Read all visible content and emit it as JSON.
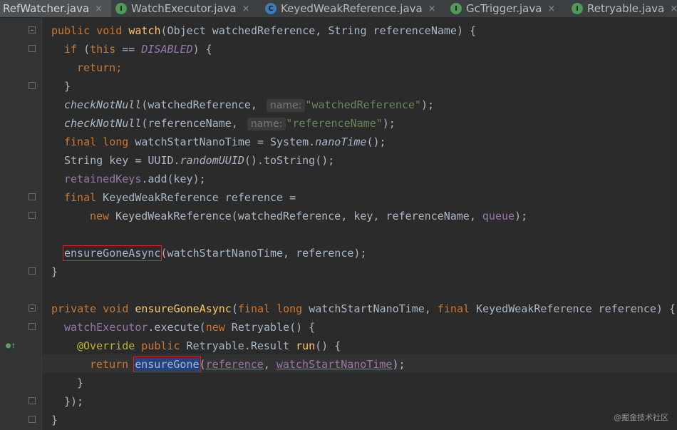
{
  "tabs": [
    {
      "label": "RefWatcher.java",
      "icon": "none",
      "active": true
    },
    {
      "label": "WatchExecutor.java",
      "icon": "interface"
    },
    {
      "label": "KeyedWeakReference.java",
      "icon": "class"
    },
    {
      "label": "GcTrigger.java",
      "icon": "interface"
    },
    {
      "label": "Retryable.java",
      "icon": "interface"
    }
  ],
  "close_glyph": "×",
  "code": {
    "l1": {
      "a": "public void ",
      "b": "watch",
      "c": "(Object watchedReference, String referenceName) {"
    },
    "l2": {
      "a": "if",
      "b": " (",
      "c": "this",
      "d": " == ",
      "e": "DISABLED",
      "f": ") {"
    },
    "l3": {
      "a": "return",
      "b": ";"
    },
    "l4": {
      "a": "}"
    },
    "l5": {
      "a": "checkNotNull",
      "b": "(watchedReference, ",
      "hint": "name:",
      "str": "\"watchedReference\"",
      "c": ");"
    },
    "l6": {
      "a": "checkNotNull",
      "b": "(referenceName, ",
      "hint": "name:",
      "str": "\"referenceName\"",
      "c": ");"
    },
    "l7": {
      "a": "final long",
      "b": " watchStartNanoTime = System.",
      "c": "nanoTime",
      "d": "();"
    },
    "l8": {
      "a": "String key = UUID.",
      "b": "randomUUID",
      "c": "().toString();"
    },
    "l9": {
      "a": "retainedKeys",
      "b": ".add(key);"
    },
    "l10": {
      "a": "final",
      "b": " KeyedWeakReference reference ="
    },
    "l11": {
      "a": "new",
      "b": " KeyedWeakReference(watchedReference, key, referenceName, ",
      "c": "queue",
      "d": ");"
    },
    "l12": {
      "a": "ensureGoneAsync",
      "b": "(watchStartNanoTime, reference);"
    },
    "l13": {
      "a": "}"
    },
    "l14": {
      "a": "private void ",
      "b": "ensureGoneAsync",
      "c": "(",
      "d": "final long",
      "e": " watchStartNanoTime, ",
      "f": "final",
      "g": " KeyedWeakReference reference) {"
    },
    "l15": {
      "a": "watchExecutor",
      "b": ".execute(",
      "c": "new",
      "d": " Retryable() {"
    },
    "l16": {
      "a": "@Override",
      "b": " public",
      "c": " Retryable.Result ",
      "d": "run",
      "e": "() {"
    },
    "l17": {
      "a": "return ",
      "b": "ensureGone",
      "c": "(",
      "d": "reference",
      "e": ", ",
      "f": "watchStartNanoTime",
      "g": ");"
    },
    "l18": {
      "a": "}"
    },
    "l19": {
      "a": "});"
    },
    "l20": {
      "a": "}"
    }
  },
  "watermark": "@掘金技术社区",
  "colors": {
    "keyword": "#cc7832",
    "method_decl": "#ffc66d",
    "field": "#9876aa",
    "string": "#6a8759",
    "annotation": "#bbb529",
    "text": "#a9b7c6",
    "background": "#2b2b2b"
  }
}
